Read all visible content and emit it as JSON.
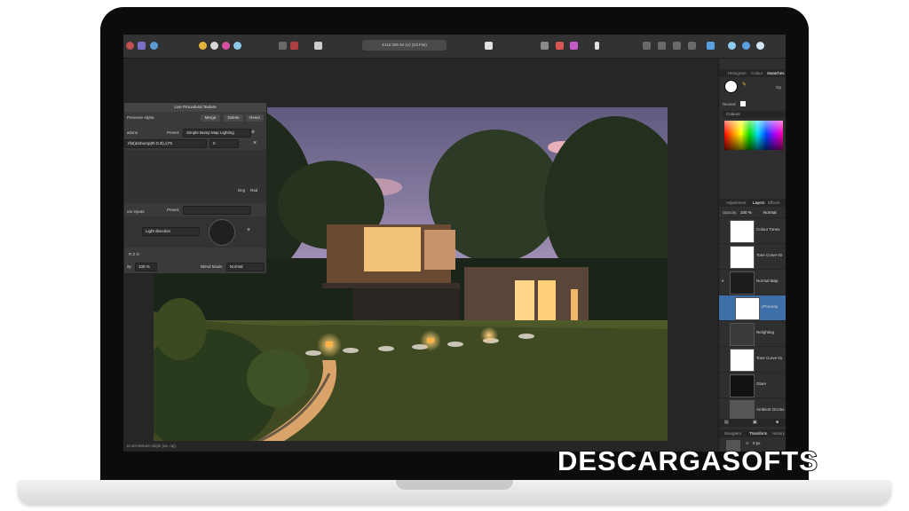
{
  "toolbar": {
    "document_title": "4416 006 50 (U) (Dil.Flat)"
  },
  "float_panel": {
    "title": "Live Procedural Texture",
    "preserve_alpha": "Preserve Alpha",
    "merge": "Merge",
    "delete": "Delete",
    "reset": "Reset",
    "equations_label": "ations",
    "preset_label": "Preset:",
    "preset_value": "Simple Bump Map Lighting",
    "equation": "rfst(darbump(R.G.B),v)*5",
    "equation_value": "0",
    "deg": "Deg",
    "rad": "Rad",
    "inputs_label": "om inputs",
    "inputs_preset_label": "Preset:",
    "light_direction": "Light direction",
    "channels": "R Z G",
    "opacity_label": "ity:",
    "opacity_value": "100 %",
    "blend_label": "Blend Mode:",
    "blend_value": "Normal"
  },
  "right_panel": {
    "top_tabs": [
      "Histogram",
      "Colour",
      "Swatches"
    ],
    "opacity_short": "Op",
    "recent_label": "Recent:",
    "palette_label": "Colours",
    "mid_tabs": [
      "Adjustment",
      "Layers",
      "Effects"
    ],
    "layer_opacity_label": "Opacity:",
    "layer_opacity_value": "100 %",
    "layer_blend": "Normal",
    "layers": [
      {
        "name": "Colour Tones",
        "suffix": "(C"
      },
      {
        "name": "Tone Curve 02",
        "suffix": "(C"
      },
      {
        "name": "Normal Map",
        "suffix": "(P"
      },
      {
        "name": "(Procedu",
        "suffix": ""
      },
      {
        "name": "Relighting",
        "suffix": "(Cur"
      },
      {
        "name": "Tone Curve 01",
        "suffix": "(C"
      },
      {
        "name": "Glare",
        "suffix": "(Pixe)"
      },
      {
        "name": "Ambient Occlus",
        "suffix": ""
      }
    ],
    "bottom_tabs": [
      "Navigator",
      "Transform",
      "History"
    ],
    "transform": {
      "x": "X:",
      "y": "Y:",
      "x_val": "0 px",
      "y_val": "0 px",
      "w": "W:",
      "h": "H:",
      "w_val": "0 px",
      "h_val": "0 px",
      "r": "R:",
      "r_val": "0 °"
    }
  },
  "status_bar": {
    "text": "to set texture origin (as, op)."
  },
  "watermark": {
    "text": "DESCARGASOFTS"
  },
  "colors": {
    "bezel": "#0c0c0c",
    "ui_dark": "#2b2b2b",
    "selection_blue": "#3d6fa8",
    "sky_purple": "#8a7aa8",
    "lamp_glow": "#f3a54a"
  }
}
